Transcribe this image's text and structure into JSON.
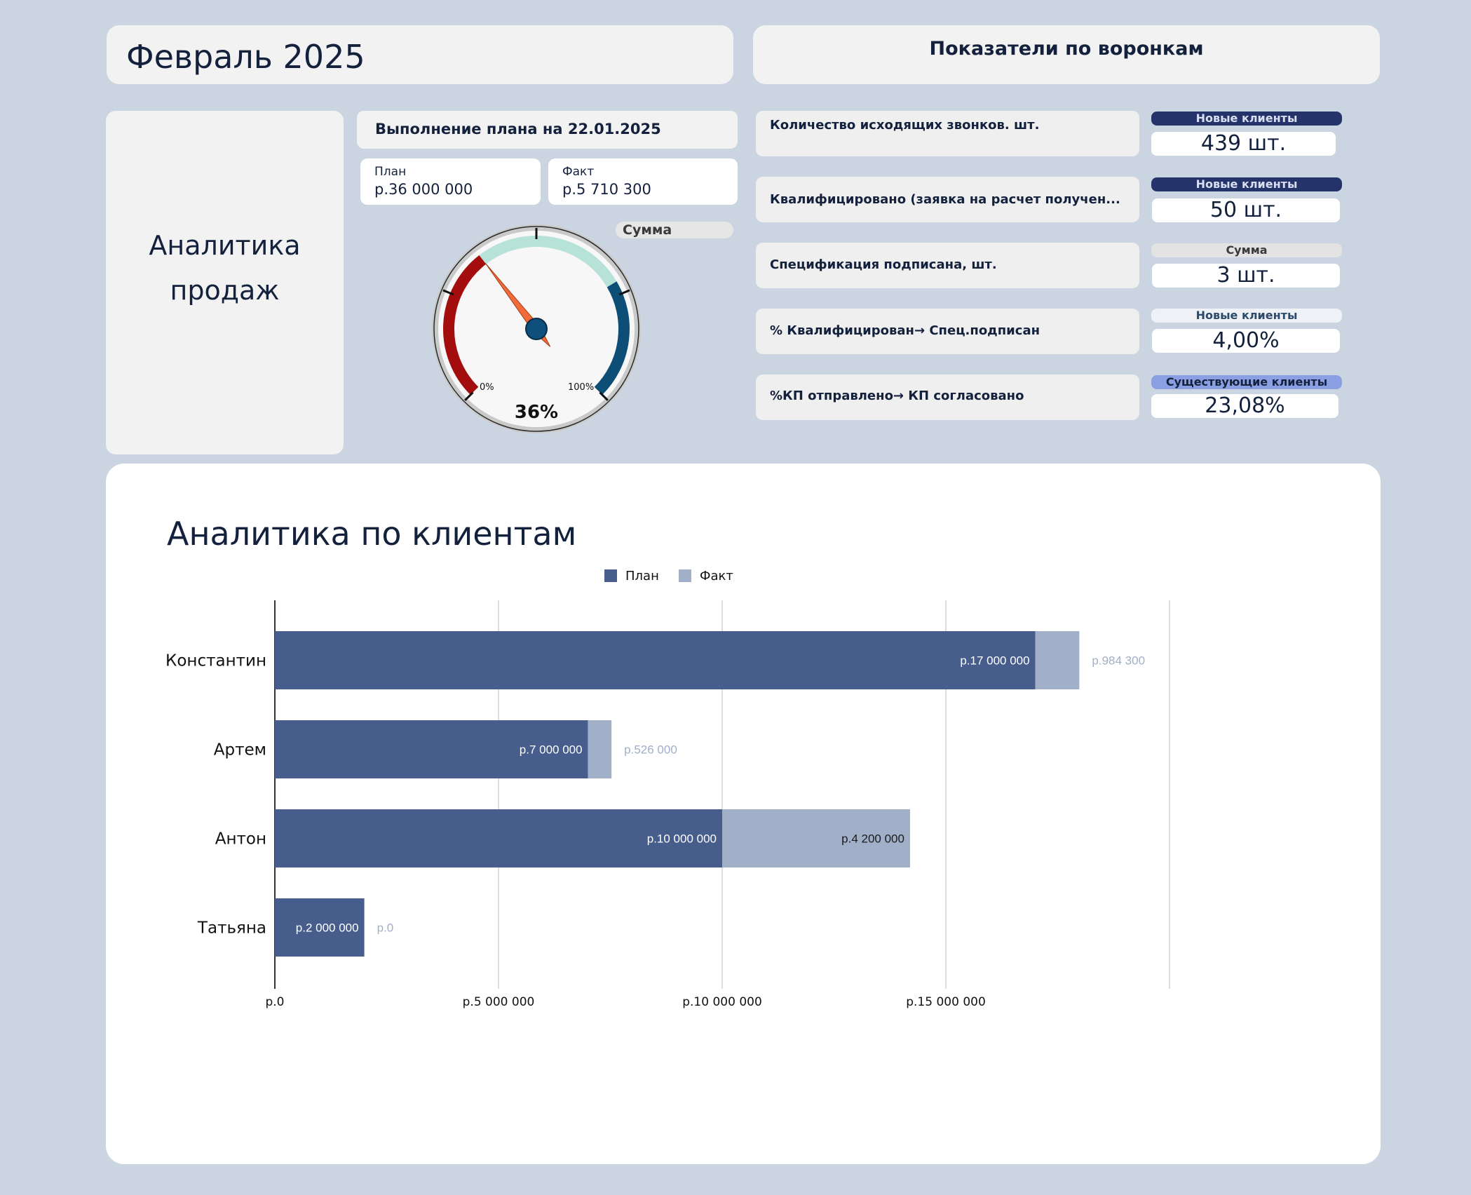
{
  "header": {
    "month_title": "Февраль 2025",
    "funnel_title": "Показатели по воронкам"
  },
  "sales_card": {
    "title": "Аналитика\nпродаж"
  },
  "plan_execution": {
    "title": "Выполнение плана на 22.01.2025",
    "plan_label": "План",
    "plan_value": "р.36 000 000",
    "fact_label": "Факт",
    "fact_value": "р.5 710 300",
    "summa_tag": "Сумма",
    "gauge": {
      "percent": 36,
      "percent_label": "36%",
      "min_label": "0%",
      "max_label": "100%"
    }
  },
  "funnel_rows": [
    {
      "label": "Количество исходящих звонков. шт.",
      "tag": "Новые клиенты",
      "value": "439 шт.",
      "tag_color": "#24346b",
      "tag_text_color": "#d9dff0"
    },
    {
      "label": "Квалифицировано (заявка на расчет получен...",
      "tag": "Новые клиенты",
      "value": "50 шт.",
      "tag_color": "#24346b",
      "tag_text_color": "#d9dff0"
    },
    {
      "label": "Спецификация подписана, шт.",
      "tag": "Сумма",
      "value": "3 шт.",
      "tag_color": "#e3e3e3",
      "tag_text_color": "#3a3a3a"
    },
    {
      "label": "% Квалифицирован→ Спец.подписан",
      "tag": "Новые клиенты",
      "value": "4,00%",
      "tag_color": "#eef1f6",
      "tag_text_color": "#2e4a6a"
    },
    {
      "label": "%КП отправлено→ КП согласовано",
      "tag": "Существующие клиенты",
      "value": "23,08%",
      "tag_color": "#8aa0e2",
      "tag_text_color": "#14213d"
    }
  ],
  "chart_data": {
    "type": "bar",
    "orientation": "horizontal",
    "stacked": true,
    "title": "Аналитика по клиентам",
    "legend_position": "top-center",
    "categories": [
      "Константин",
      "Артем",
      "Антон",
      "Татьяна"
    ],
    "series": [
      {
        "name": "План",
        "values": [
          17000000,
          7000000,
          10000000,
          2000000
        ],
        "labels": [
          "р.17 000 000",
          "р.7 000 000",
          "р.10 000 000",
          "р.2 000 000"
        ],
        "color": "#475d8c"
      },
      {
        "name": "Факт",
        "values": [
          984300,
          526000,
          4200000,
          0
        ],
        "labels": [
          "р.984 300",
          "р.526 000",
          "р.4 200 000",
          "р.0"
        ],
        "color": "#a1afc8"
      }
    ],
    "xlim": [
      0,
      20000000
    ],
    "xticks": [
      0,
      5000000,
      10000000,
      15000000
    ],
    "xtick_labels": [
      "р.0",
      "р.5 000 000",
      "р.10 000 000",
      "р.15 000 000"
    ],
    "grid": true
  }
}
